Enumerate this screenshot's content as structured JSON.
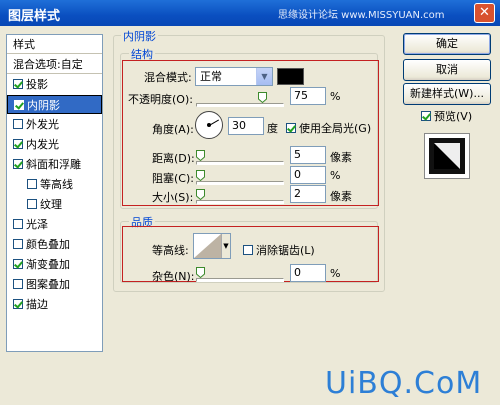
{
  "window": {
    "title": "图层样式",
    "watermark": "思缘设计论坛 www.MISSYUAN.com",
    "close_glyph": "✕"
  },
  "sidebar": {
    "header": "样式",
    "blend_options": "混合选项:自定",
    "items": [
      {
        "label": "投影",
        "checked": true
      },
      {
        "label": "内阴影",
        "checked": true,
        "selected": true
      },
      {
        "label": "外发光",
        "checked": false
      },
      {
        "label": "内发光",
        "checked": true
      },
      {
        "label": "斜面和浮雕",
        "checked": true
      },
      {
        "label": "等高线",
        "checked": false,
        "indent": true
      },
      {
        "label": "纹理",
        "checked": false,
        "indent": true
      },
      {
        "label": "光泽",
        "checked": false
      },
      {
        "label": "颜色叠加",
        "checked": false
      },
      {
        "label": "渐变叠加",
        "checked": true
      },
      {
        "label": "图案叠加",
        "checked": false
      },
      {
        "label": "描边",
        "checked": true
      }
    ]
  },
  "inner_shadow": {
    "group_title": "内阴影",
    "structure": {
      "title": "结构",
      "blend_mode_label": "混合模式:",
      "blend_mode_value": "正常",
      "blend_color": "#000000",
      "opacity_label": "不透明度(O):",
      "opacity_value": "75",
      "opacity_unit": "%",
      "opacity_fraction": 0.75,
      "angle_label": "角度(A):",
      "angle_value": "30",
      "angle_unit": "度",
      "global_light_label": "使用全局光(G)",
      "global_light_checked": true,
      "distance_label": "距离(D):",
      "distance_value": "5",
      "distance_unit": "像素",
      "choke_label": "阻塞(C):",
      "choke_value": "0",
      "choke_unit": "%",
      "size_label": "大小(S):",
      "size_value": "2",
      "size_unit": "像素"
    },
    "quality": {
      "title": "品质",
      "contour_label": "等高线:",
      "anti_alias_label": "消除锯齿(L)",
      "anti_alias_checked": false,
      "noise_label": "杂色(N):",
      "noise_value": "0",
      "noise_unit": "%"
    }
  },
  "buttons": {
    "ok": "确定",
    "cancel": "取消",
    "new_style": "新建样式(W)...",
    "preview_label": "预览(V)",
    "preview_checked": true
  },
  "footer": {
    "logo": "UiBQ.CoM"
  },
  "colors": {
    "titlebar": "#0a4fc0",
    "dialog_bg": "#ece9d8",
    "selection": "#316ac5",
    "highlight_box": "#c42121",
    "legend_text": "#0046d5",
    "logo": "#2d7fd6"
  }
}
